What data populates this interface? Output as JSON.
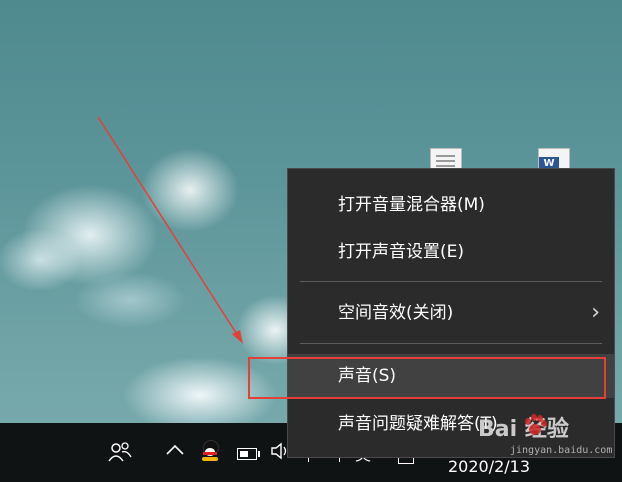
{
  "context_menu": {
    "items": [
      {
        "label": "打开音量混合器(M)"
      },
      {
        "label": "打开声音设置(E)"
      },
      {
        "label": "空间音效(关闭)",
        "has_submenu": true,
        "submenu_glyph": "›"
      },
      {
        "label": "声音(S)",
        "highlighted": true
      },
      {
        "label": "声音问题疑难解答(T)"
      }
    ]
  },
  "taskbar": {
    "date": "2020/2/13",
    "tray_icons": [
      "people-icon",
      "chevron-up-icon",
      "qq-icon",
      "battery-icon",
      "volume-icon",
      "keyboard-icon",
      "ime-icon",
      "action-center-icon"
    ],
    "ime_label": "英"
  },
  "watermark": {
    "brand": "Bai  经验",
    "url": "jingyan.baidu.com"
  },
  "colors": {
    "annotation": "#e3403a",
    "menu_background": "#2b2b2b",
    "menu_hover": "#414141",
    "taskbar": "#101314"
  }
}
